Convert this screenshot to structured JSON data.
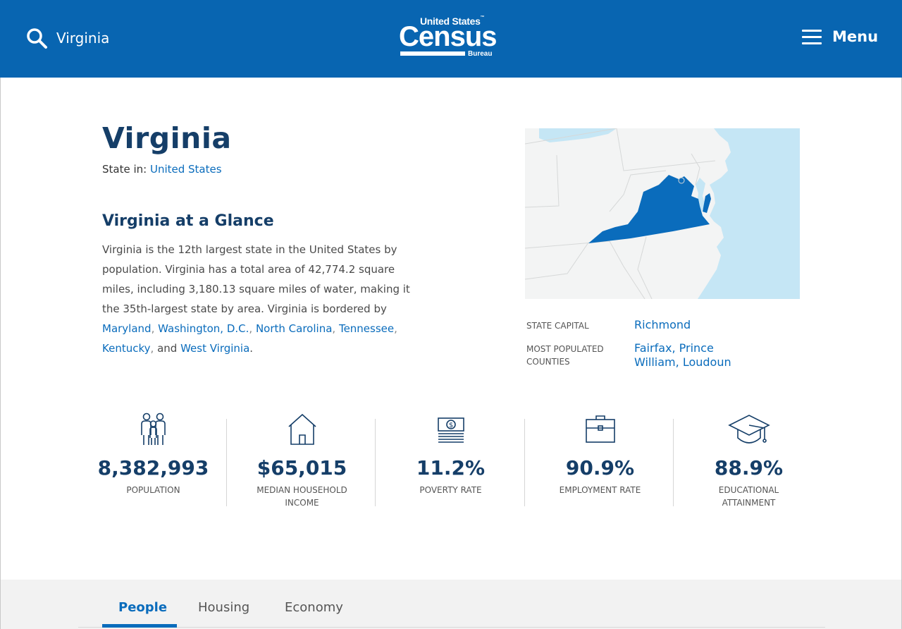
{
  "header": {
    "search_value": "Virginia",
    "logo": {
      "line1": "United States",
      "line2": "Census",
      "line3": "Bureau",
      "tm": "™"
    },
    "menu_label": "Menu"
  },
  "profile": {
    "title": "Virginia",
    "state_in_label": "State in: ",
    "state_in_link": "United States"
  },
  "glance": {
    "title": "Virginia at a Glance",
    "text": "Virginia is the 12th largest state in the United States by population. Virginia has a total area of 42,774.2 square miles, including 3,180.13 square miles of water, making it the 35th-largest state by area. Virginia is bordered by ",
    "borders": [
      "Maryland",
      "Washington, D.C.",
      "North Carolina",
      "Tennessee",
      "Kentucky",
      "West Virginia"
    ],
    "sep": ",",
    "and": "and",
    "end": "."
  },
  "facts": {
    "capital_label": "STATE CAPITAL",
    "capital_value": "Richmond",
    "counties_label": "MOST POPULATED COUNTIES",
    "counties_value": "Fairfax, Prince William, Loudoun"
  },
  "stats": [
    {
      "icon": "people-icon",
      "value": "8,382,993",
      "label": "POPULATION"
    },
    {
      "icon": "house-icon",
      "value": "$65,015",
      "label": "MEDIAN HOUSEHOLD INCOME"
    },
    {
      "icon": "money-icon",
      "value": "11.2%",
      "label": "POVERTY RATE"
    },
    {
      "icon": "briefcase-icon",
      "value": "90.9%",
      "label": "EMPLOYMENT RATE"
    },
    {
      "icon": "graduation-cap-icon",
      "value": "88.9%",
      "label": "EDUCATIONAL ATTAINMENT"
    }
  ],
  "tabs": [
    {
      "label": "People",
      "active": true
    },
    {
      "label": "Housing",
      "active": false
    },
    {
      "label": "Economy",
      "active": false
    }
  ],
  "colors": {
    "header_bg": "#0865b1",
    "title": "#153e68",
    "link": "#0a6cbc",
    "state_fill": "#0a6cbc",
    "water": "#c5e6f5",
    "land": "#f3f4f4"
  }
}
